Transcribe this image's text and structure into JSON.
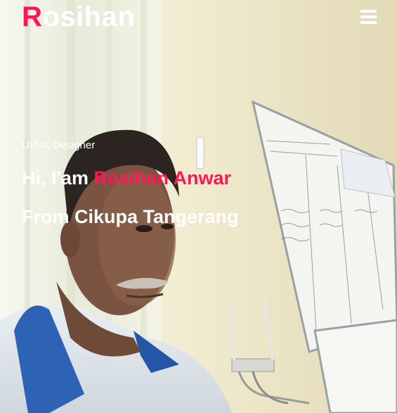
{
  "brand": {
    "first_letter": "R",
    "rest": "osihan"
  },
  "menu": {
    "icon": "hamburger-icon"
  },
  "hero": {
    "subtitle": "UI/UX Designer",
    "greeting_prefix": "Hi, I'am ",
    "name": "Rosihan Anwar",
    "location": "From Cikupa Tangerang"
  },
  "colors": {
    "accent": "#ff1654",
    "text": "#ffffff"
  }
}
